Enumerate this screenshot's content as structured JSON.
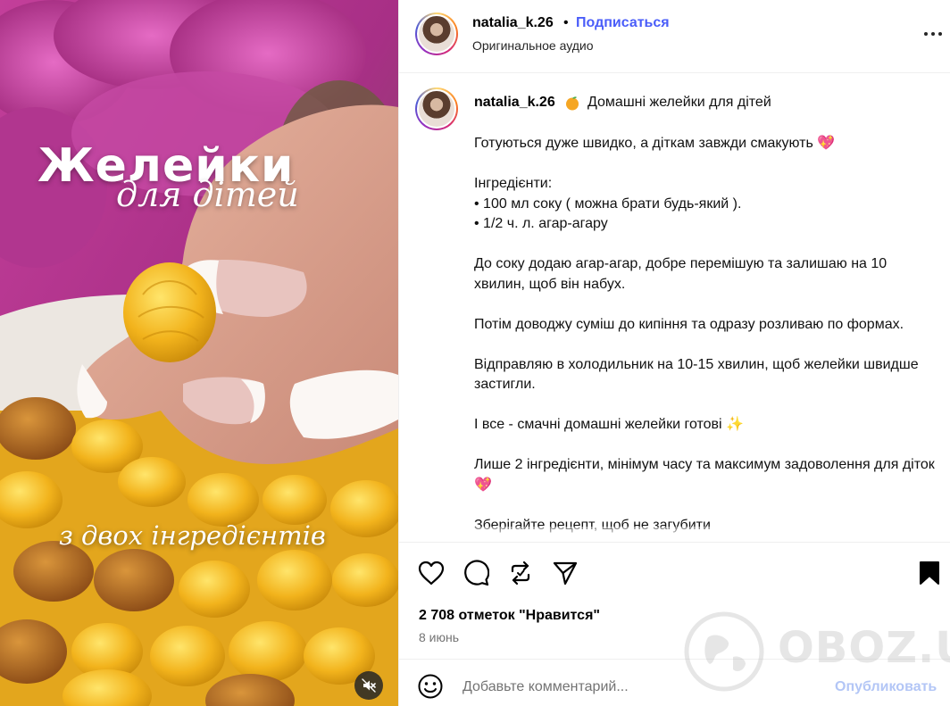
{
  "media": {
    "overlay_title": "Желейки",
    "overlay_subtitle": "для дітей",
    "overlay_bottom": "з двох інгредієнтів",
    "mute_icon": "sound-off-icon"
  },
  "header": {
    "username": "natalia_k.26",
    "separator": "•",
    "follow_label": "Подписаться",
    "audio_label": "Оригинальное аудио",
    "more_icon": "more-horizontal-icon"
  },
  "caption": {
    "username": "natalia_k.26",
    "headline": "Домашні желейки для дітей",
    "emoji_orange": "orange-emoji",
    "paragraphs": [
      "Готуються дуже швидко, а діткам завжди смакують 💖",
      "Інгредієнти:",
      "• 100 мл соку ( можна брати будь-який ).",
      "• 1/2 ч. л. агар-агару",
      "До соку додаю агар-агар, добре перемішую та залишаю на 10 хвилин, щоб він набух.",
      "Потім доводжу суміш до кипіння та одразу розливаю по формах.",
      "Відправляю в холодильник на 10-15 хвилин, щоб желейки швидше застигли.",
      "І все - смачні домашні желейки готові ✨",
      "Лише 2 інгредієнти, мінімум часу та максимум задоволення для діток 💖",
      "Зберігайте рецепт, щоб не загубити"
    ]
  },
  "actions": {
    "likes_text": "2 708 отметок \"Нравится\"",
    "date": "8 июнь",
    "icons": [
      "heart-icon",
      "comment-icon",
      "repost-icon",
      "share-icon",
      "bookmark-icon"
    ]
  },
  "comment": {
    "placeholder": "Добавьте комментарий...",
    "post_label": "Опубликовать",
    "emoji_icon": "smiley-icon"
  },
  "watermark": {
    "text": "OBOZ.UA"
  },
  "colors": {
    "link_blue": "#4a5df9",
    "post_disabled": "#b3c6f6",
    "muted_text": "#737373",
    "divider": "#efefef"
  }
}
